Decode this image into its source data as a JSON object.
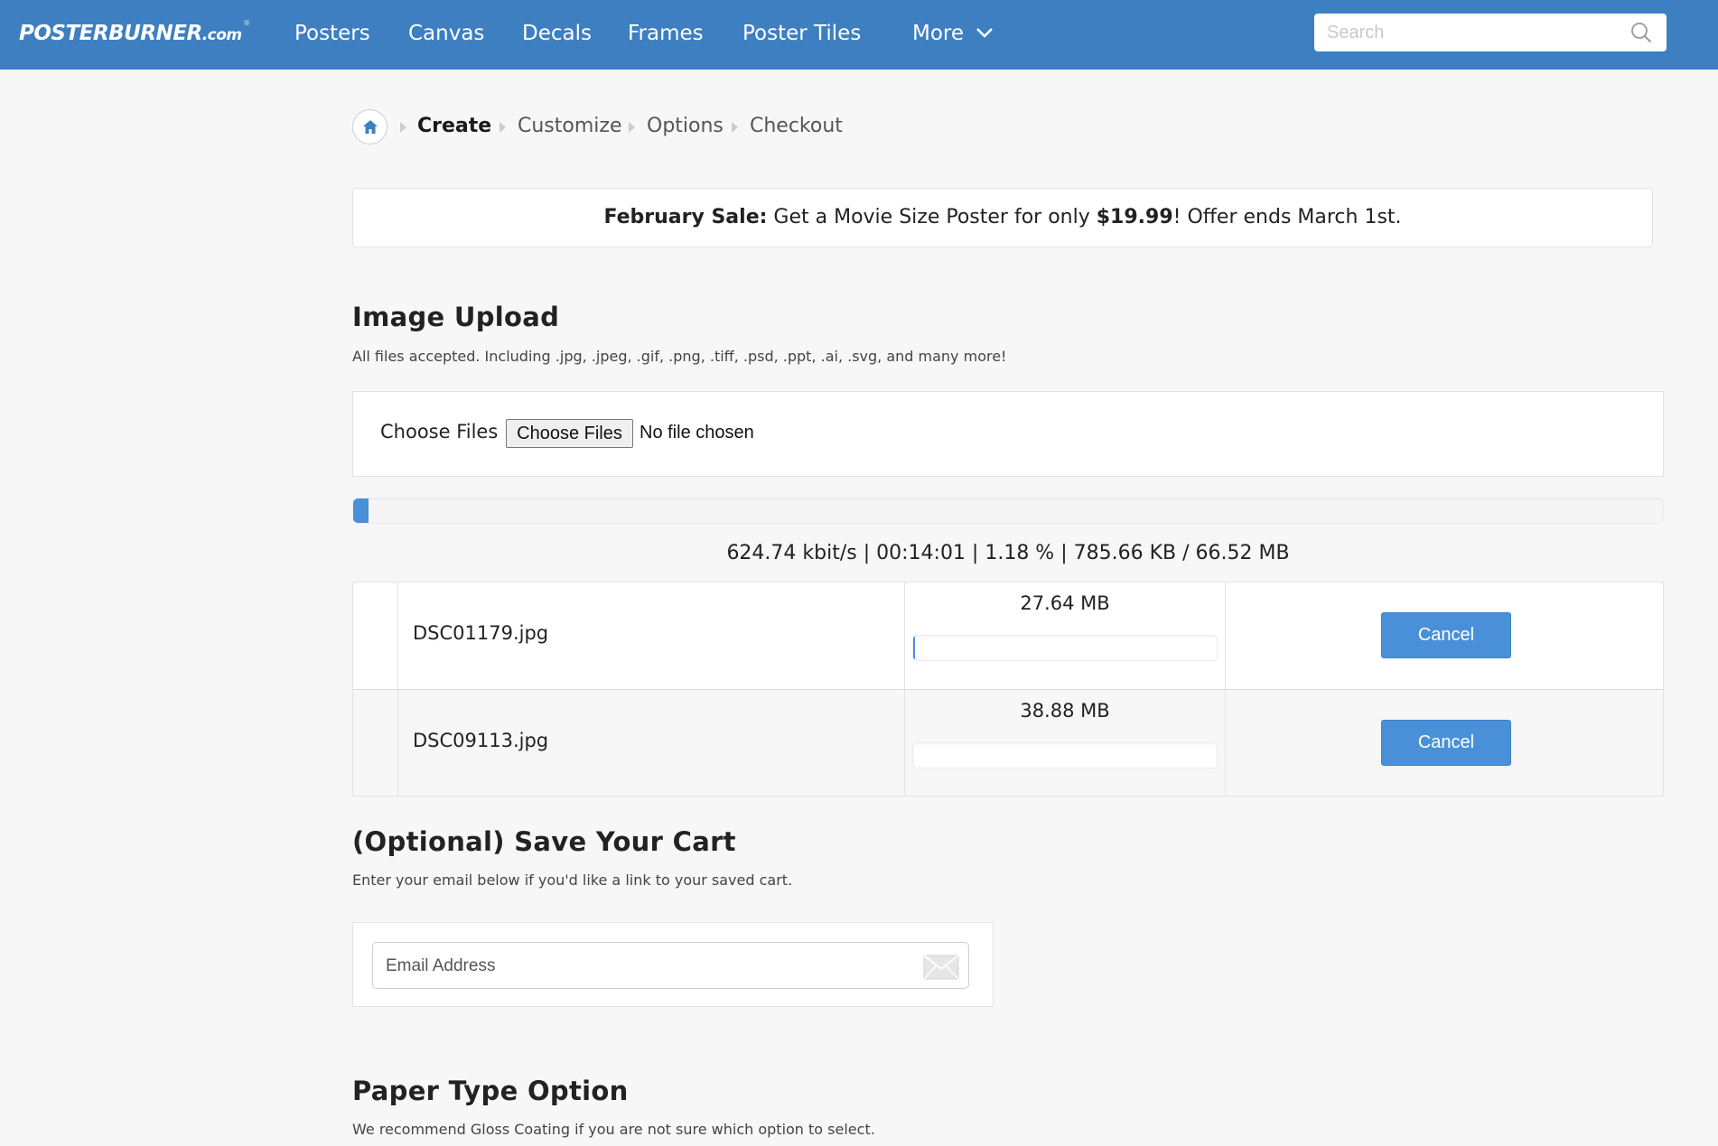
{
  "header": {
    "logo_main": "POSTERBURNER",
    "logo_suffix": ".com",
    "logo_reg": "®",
    "nav": [
      {
        "label": "Posters"
      },
      {
        "label": "Canvas"
      },
      {
        "label": "Decals"
      },
      {
        "label": "Frames"
      },
      {
        "label": "Poster Tiles"
      },
      {
        "label": "More"
      }
    ],
    "search_placeholder": "Search",
    "search_value": ""
  },
  "breadcrumb": {
    "home_icon": "home-icon",
    "steps": [
      "Create",
      "Customize",
      "Options",
      "Checkout"
    ],
    "active": "Create"
  },
  "sale_banner": {
    "label": "February Sale:",
    "text_before": " Get a Movie Size Poster for only ",
    "price": "$19.99",
    "text_after": "! Offer ends March 1st."
  },
  "image_upload": {
    "title": "Image Upload",
    "subtitle": "All files accepted. Including .jpg, .jpeg, .gif, .png, .tiff, .psd, .ppt, .ai, .svg, and many more!",
    "field_label": "Choose Files",
    "button_label": "Choose Files",
    "status_text": "No file chosen",
    "overall_progress_fraction": 0.0118,
    "stats": "624.74 kbit/s | 00:14:01 | 1.18 % | 785.66 KB / 66.52 MB",
    "files": [
      {
        "name": "DSC01179.jpg",
        "size": "27.64 MB",
        "progress_fraction": 0.005,
        "cancel_label": "Cancel"
      },
      {
        "name": "DSC09113.jpg",
        "size": "38.88 MB",
        "progress_fraction": 0,
        "cancel_label": "Cancel"
      }
    ]
  },
  "save_cart": {
    "title": "(Optional) Save Your Cart",
    "subtitle": "Enter your email below if you'd like a link to your saved cart.",
    "email_placeholder": "Email Address",
    "email_value": "",
    "email_icon": "envelope-icon"
  },
  "paper_type": {
    "title": "Paper Type Option",
    "subtitle": "We recommend Gloss Coating if you are not sure which option to select."
  },
  "colors": {
    "header_bg": "#3d7fc0",
    "accent": "#4a90d9",
    "page_bg": "#f7f7f7"
  }
}
